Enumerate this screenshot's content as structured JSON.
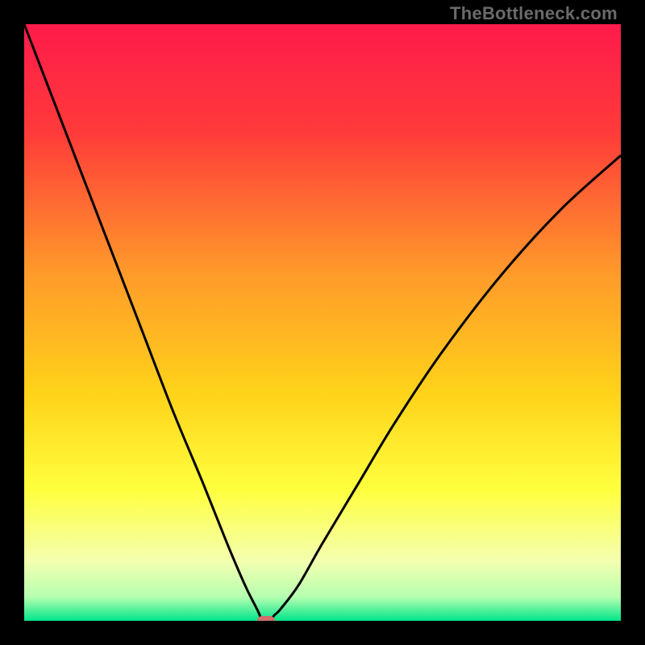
{
  "watermark": "TheBottleneck.com",
  "colors": {
    "frame": "#000000",
    "gradient_stops": [
      {
        "pct": 0,
        "color": "#ff1b4b"
      },
      {
        "pct": 18,
        "color": "#ff3a3a"
      },
      {
        "pct": 42,
        "color": "#ff9b2a"
      },
      {
        "pct": 62,
        "color": "#ffd31a"
      },
      {
        "pct": 78,
        "color": "#ffff3e"
      },
      {
        "pct": 90,
        "color": "#f4ffb0"
      },
      {
        "pct": 96,
        "color": "#b6ffb0"
      },
      {
        "pct": 100,
        "color": "#00e58a"
      }
    ],
    "curve_stroke": "#000000",
    "marker_fill": "#cf6d6d"
  },
  "chart_data": {
    "type": "line",
    "title": "",
    "xlabel": "",
    "ylabel": "",
    "xlim": [
      0,
      100
    ],
    "ylim": [
      0,
      100
    ],
    "series": [
      {
        "name": "bottleneck-curve",
        "x": [
          0,
          5,
          10,
          15,
          20,
          25,
          30,
          34,
          37,
          39,
          40,
          41,
          42,
          43,
          46,
          50,
          56,
          62,
          70,
          80,
          90,
          100
        ],
        "values": [
          100,
          87,
          74,
          61,
          48,
          35,
          23,
          13,
          6,
          2,
          0,
          0,
          1,
          2,
          6,
          13,
          23,
          33,
          45,
          58,
          69,
          78
        ]
      }
    ],
    "annotations": [
      {
        "name": "min-marker",
        "x": 40.5,
        "y": 0.0
      }
    ]
  }
}
